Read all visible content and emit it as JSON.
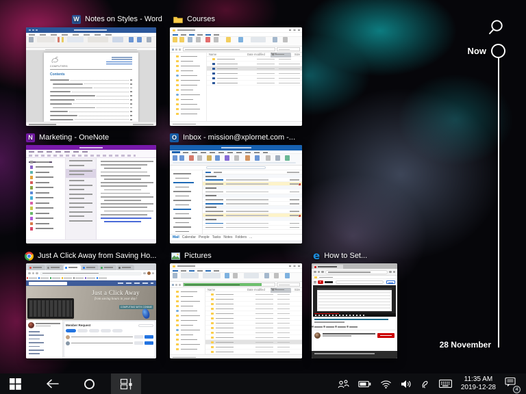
{
  "colors": {
    "word": "#2b579a",
    "onenote": "#7719aa",
    "outlook": "#1761b0",
    "edgeblue": "#1c8fe0",
    "fb": "#3e5c9a",
    "ytred": "#cc0000",
    "folder": "#fbce4a"
  },
  "icons": {
    "word_glyph": "W",
    "onenote_glyph": "N",
    "outlook_glyph": "O",
    "edge_glyph": "e"
  },
  "cards": {
    "word": {
      "title": "Notes on Styles - Word",
      "logo_text": "COMPUTERS",
      "contents_heading": "Contents"
    },
    "courses": {
      "title": "Courses",
      "columns": {
        "name": "Name",
        "date": "Date modified",
        "type": "Type",
        "size": "Size"
      }
    },
    "onenote": {
      "title": "Marketing - OneNote"
    },
    "outlook": {
      "title": "Inbox - mission@xplornet.com -...",
      "nav": [
        "Mail",
        "Calendar",
        "People",
        "Tasks",
        "Notes",
        "Folders",
        "..."
      ]
    },
    "chrome": {
      "title": "Just A Click Away from Saving Ho...",
      "cover_title": "Just a Click Away",
      "cover_subtitle": "from saving hours in your day!",
      "cover_badge": "COMPUTING WITH CONNIE",
      "section_header": "Member Request"
    },
    "pictures": {
      "title": "Pictures",
      "columns": {
        "name": "Name",
        "date": "Date modified",
        "type": "Type",
        "size": "Size"
      }
    },
    "edge": {
      "title": "How to Set..."
    }
  },
  "timeline": {
    "now_label": "Now",
    "date_label": "28 November"
  },
  "taskbar": {
    "time": "11:35 AM",
    "date": "2019-12-28",
    "notification_count": "4"
  }
}
